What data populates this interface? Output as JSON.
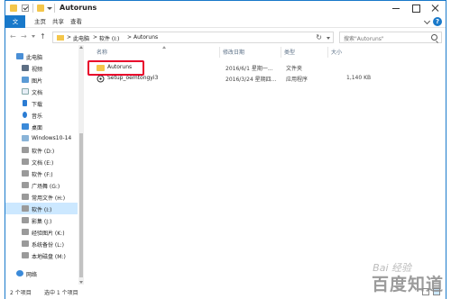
{
  "window": {
    "title": "Autoruns",
    "accent": "#1979ca"
  },
  "ribbon": {
    "tabs": [
      "文件",
      "主页",
      "共享",
      "查看"
    ]
  },
  "address": {
    "segments": [
      "此电脑",
      "软件 (I:)",
      "Autoruns"
    ],
    "separator": ">"
  },
  "search": {
    "placeholder": "搜索\"Autoruns\""
  },
  "sidebar": {
    "items": [
      {
        "label": "此电脑",
        "icon": "computer-icon"
      },
      {
        "label": "视频",
        "icon": "video-icon"
      },
      {
        "label": "图片",
        "icon": "pictures-icon"
      },
      {
        "label": "文档",
        "icon": "documents-icon"
      },
      {
        "label": "下载",
        "icon": "download-icon"
      },
      {
        "label": "音乐",
        "icon": "music-icon"
      },
      {
        "label": "桌面",
        "icon": "desktop-icon"
      },
      {
        "label": "Windows10-14",
        "icon": "drive-icon"
      },
      {
        "label": "软件 (D:)",
        "icon": "drive-icon"
      },
      {
        "label": "文档 (E:)",
        "icon": "drive-icon"
      },
      {
        "label": "软件 (F:)",
        "icon": "drive-icon"
      },
      {
        "label": "广场舞 (G:)",
        "icon": "drive-icon"
      },
      {
        "label": "常用文件 (H:)",
        "icon": "drive-icon"
      },
      {
        "label": "软件 (I:)",
        "icon": "drive-icon",
        "selected": true
      },
      {
        "label": "影集 (J:)",
        "icon": "drive-icon"
      },
      {
        "label": "经验图片 (K:)",
        "icon": "drive-icon"
      },
      {
        "label": "系统备份 (L:)",
        "icon": "drive-icon"
      },
      {
        "label": "本地磁盘 (M:)",
        "icon": "drive-icon"
      },
      {
        "label": "网络",
        "icon": "network-icon"
      }
    ]
  },
  "columns": {
    "name": "名称",
    "date": "修改日期",
    "type": "类型",
    "size": "大小"
  },
  "files": [
    {
      "name": "Autoruns",
      "date": "2016/6/1 星期一...",
      "type": "文件夹",
      "size": "",
      "icon": "folder-icon"
    },
    {
      "name": "Setup_oemtongyi3",
      "date": "2016/3/24 星期四...",
      "type": "应用程序",
      "size": "1,140 KB",
      "icon": "application-icon"
    }
  ],
  "status": {
    "item_count": "2 个项目",
    "selected": "选中 1 个项目"
  },
  "watermark": {
    "brand": "Bai 经验",
    "text": "百度知道"
  }
}
